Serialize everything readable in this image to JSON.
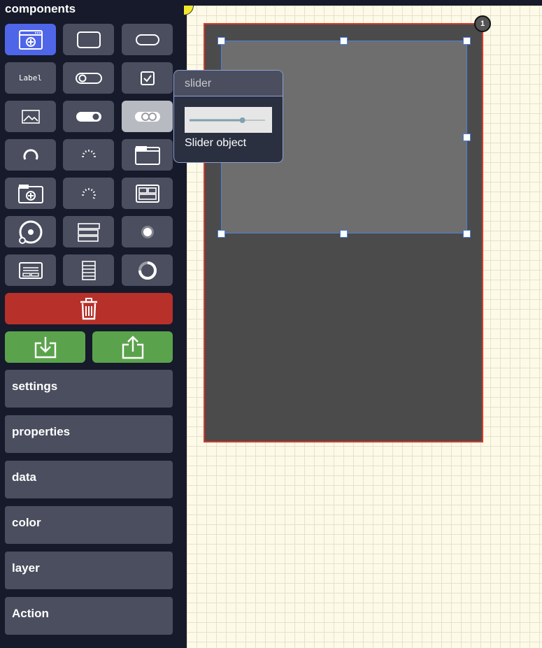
{
  "sidebar": {
    "title": "components",
    "tools": [
      {
        "icon": "window-add-icon",
        "active": true
      },
      {
        "icon": "rectangle-icon"
      },
      {
        "icon": "rounded-rectangle-icon"
      },
      {
        "icon": "label-icon",
        "text": "Label"
      },
      {
        "icon": "toggle-off-icon"
      },
      {
        "icon": "checkbox-icon"
      },
      {
        "icon": "image-icon"
      },
      {
        "icon": "toggle-on-icon"
      },
      {
        "icon": "slider-icon",
        "hover": true
      },
      {
        "icon": "arc-icon"
      },
      {
        "icon": "spinner-icon"
      },
      {
        "icon": "tabview-icon"
      },
      {
        "icon": "folder-add-icon"
      },
      {
        "icon": "spinner-alt-icon"
      },
      {
        "icon": "button-matrix-icon"
      },
      {
        "icon": "color-wheel-icon"
      },
      {
        "icon": "list-icon"
      },
      {
        "icon": "led-icon"
      },
      {
        "icon": "keyboard-icon"
      },
      {
        "icon": "roller-icon"
      },
      {
        "icon": "circular-progress-icon"
      }
    ],
    "delete_icon": "trash-icon",
    "import_icon": "download-icon",
    "export_icon": "upload-icon",
    "sections": [
      {
        "label": "settings"
      },
      {
        "label": "properties"
      },
      {
        "label": "data"
      },
      {
        "label": "color"
      },
      {
        "label": "layer"
      },
      {
        "label": "Action"
      }
    ]
  },
  "tooltip": {
    "title": "slider",
    "description": "Slider object",
    "slider_value": 0.7
  },
  "canvas": {
    "screen_badge": "1",
    "colors": {
      "screen_border": "#d83a2a",
      "selection": "#4d7fd8",
      "accent": "#4f66e8",
      "delete": "#b7302a",
      "io": "#5aa34c"
    }
  }
}
